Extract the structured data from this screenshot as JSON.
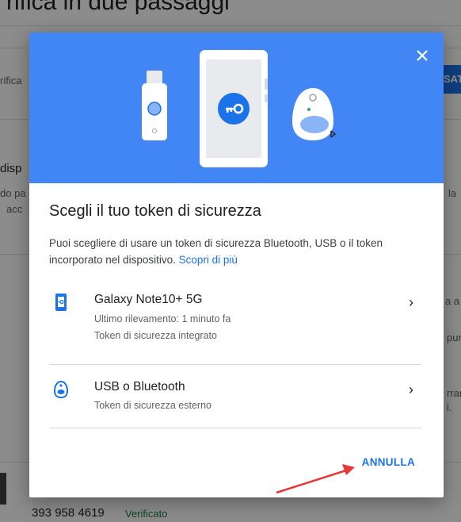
{
  "background": {
    "title_fragment": "rifica in due passaggi",
    "fragments": [
      "rifica",
      "disp",
      "do pa",
      "acc",
      "SAT",
      "la",
      "a a c",
      "punt",
      "rran",
      "i."
    ],
    "phone": "393 958 4619",
    "phone_status": "Verificato"
  },
  "dialog": {
    "heading": "Scegli il tuo token di sicurezza",
    "description": "Puoi scegliere di usare un token di sicurezza Bluetooth, USB o il token incorporato nel dispositivo.",
    "learn_more": "Scopri di più",
    "options": [
      {
        "icon": "phone-key-icon",
        "title": "Galaxy Note10+ 5G",
        "subtitle1": "Ultimo rilevamento: 1 minuto fa",
        "subtitle2": "Token di sicurezza integrato"
      },
      {
        "icon": "bluetooth-key-icon",
        "title": "USB o Bluetooth",
        "subtitle1": "Token di sicurezza esterno"
      }
    ],
    "cancel_label": "ANNULLA"
  },
  "colors": {
    "hero": "#4285f4",
    "accent": "#1a73e8",
    "arrow": "#e53935",
    "verified": "#188038"
  }
}
